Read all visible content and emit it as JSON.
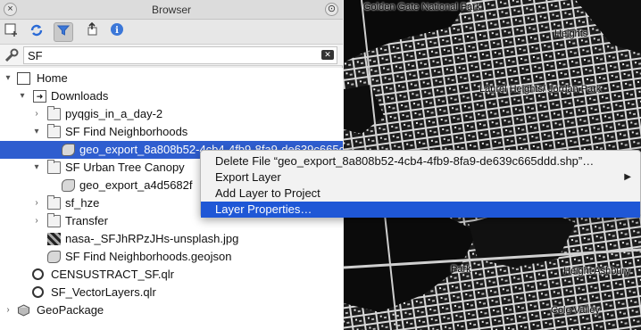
{
  "panel": {
    "title": "Browser",
    "toolbar": {
      "add": "add-selected-layers-icon",
      "refresh": "refresh-icon",
      "filter": "filter-icon",
      "collapse": "collapse-all-icon",
      "info": "properties-icon"
    },
    "search": {
      "value": "SF"
    }
  },
  "tree": {
    "items": [
      {
        "label": "Home",
        "expanded": true,
        "icon": "home-folder-icon"
      },
      {
        "label": "Downloads",
        "expanded": true,
        "icon": "downloads-folder-icon"
      },
      {
        "label": "pyqgis_in_a_day-2",
        "expanded": false,
        "icon": "folder-icon"
      },
      {
        "label": "SF Find Neighborhoods",
        "expanded": true,
        "icon": "folder-icon"
      },
      {
        "label": "geo_export_8a808b52-4cb4-4fb9-8fa9-de639c665ddd.shp",
        "selected": true,
        "icon": "polygon-layer-icon"
      },
      {
        "label": "SF Urban Tree Canopy",
        "expanded": true,
        "icon": "folder-icon"
      },
      {
        "label": "geo_export_a4d5682f",
        "icon": "polygon-layer-icon"
      },
      {
        "label": "sf_hze",
        "expanded": false,
        "icon": "folder-icon"
      },
      {
        "label": "Transfer",
        "expanded": false,
        "icon": "folder-icon"
      },
      {
        "label": "nasa-_SFJhRPzJHs-unsplash.jpg",
        "icon": "raster-icon"
      },
      {
        "label": "SF Find Neighborhoods.geojson",
        "icon": "polygon-layer-icon"
      },
      {
        "label": "CENSUSTRACT_SF.qlr",
        "icon": "qgis-layer-definition-icon"
      },
      {
        "label": "SF_VectorLayers.qlr",
        "icon": "qgis-layer-definition-icon"
      },
      {
        "label": "GeoPackage",
        "expanded": false,
        "icon": "geopackage-icon"
      }
    ]
  },
  "context_menu": {
    "items": [
      {
        "label": "Delete File “geo_export_8a808b52-4cb4-4fb9-8fa9-de639c665ddd.shp”…"
      },
      {
        "label": "Export Layer",
        "has_submenu": true
      },
      {
        "label": "Add Layer to Project"
      },
      {
        "label": "Layer Properties…",
        "highlighted": true
      }
    ]
  },
  "map": {
    "labels": [
      "Golden Gate National Park",
      "Heights",
      "Laurel Heights/ Jordan Park",
      "Park",
      "Height Ashbury",
      "Cole Valley"
    ]
  },
  "colors": {
    "selection": "#2f5ecf",
    "menu_highlight": "#1f57d6"
  }
}
